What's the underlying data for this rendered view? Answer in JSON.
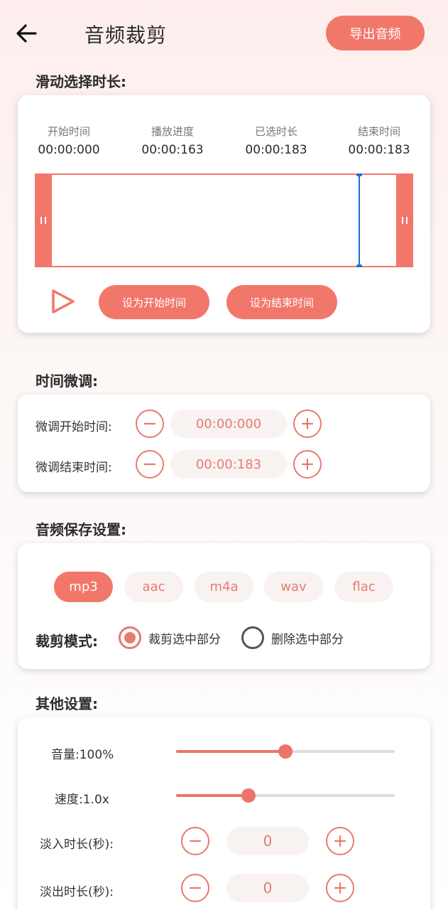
{
  "header": {
    "back_icon": "arrow-left-icon",
    "title": "音频裁剪",
    "export_label": "导出音频"
  },
  "sections": {
    "select_duration": "滑动选择时长:",
    "fine_tune": "时间微调:",
    "save_settings": "音频保存设置:",
    "other_settings": "其他设置:"
  },
  "stats": [
    {
      "label": "开始时间",
      "value": "00:00:000"
    },
    {
      "label": "播放进度",
      "value": "00:00:163"
    },
    {
      "label": "已选时长",
      "value": "00:00:183"
    },
    {
      "label": "结束时间",
      "value": "00:00:183"
    }
  ],
  "waveform": {
    "playhead_fraction": 0.89
  },
  "controls": {
    "play_icon": "play-icon",
    "set_start_label": "设为开始时间",
    "set_end_label": "设为结束时间"
  },
  "fine_tune": {
    "start_label": "微调开始时间:",
    "start_value": "00:00:000",
    "end_label": "微调结束时间:",
    "end_value": "00:00:183"
  },
  "formats": {
    "options": [
      "mp3",
      "aac",
      "m4a",
      "wav",
      "flac"
    ],
    "selected": "mp3"
  },
  "crop_mode": {
    "label": "裁剪模式:",
    "options": [
      "裁剪选中部分",
      "删除选中部分"
    ],
    "selected_index": 0
  },
  "other": {
    "volume_label": "音量:100%",
    "volume_fraction": 0.5,
    "speed_label": "速度:1.0x",
    "speed_fraction": 0.33,
    "fade_in_label": "淡入时长(秒):",
    "fade_in_value": "0",
    "fade_out_label": "淡出时长(秒):",
    "fade_out_value": "0"
  },
  "colors": {
    "accent": "#f2776b",
    "playhead": "#1d6fd6",
    "field_bg": "#f8f2f1"
  }
}
